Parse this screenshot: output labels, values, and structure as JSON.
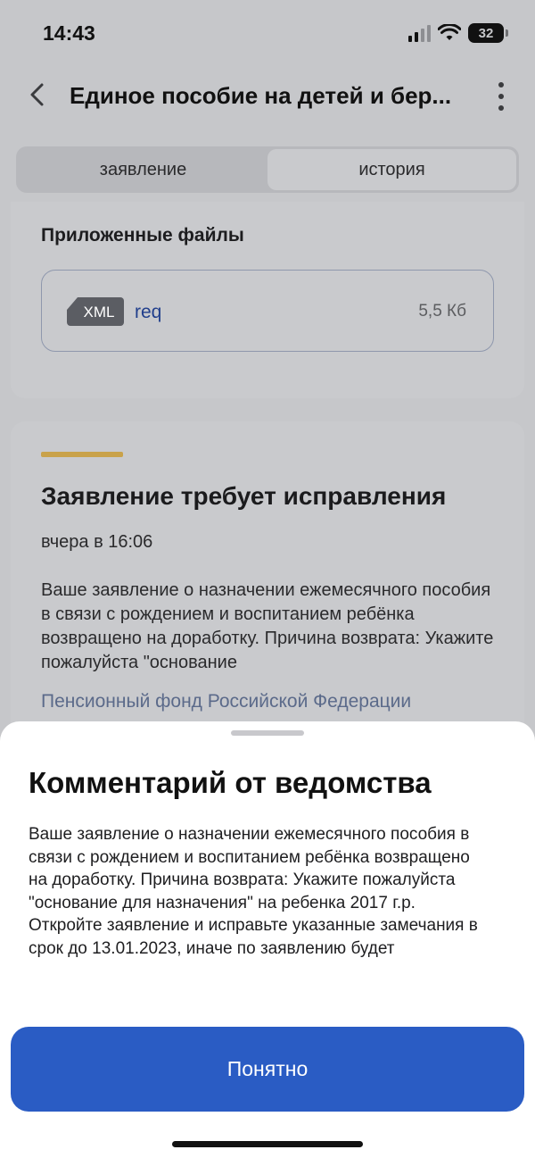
{
  "status_bar": {
    "time": "14:43",
    "battery": "32"
  },
  "header": {
    "title": "Единое пособие на детей и бер..."
  },
  "tabs": [
    {
      "label": "заявление",
      "active": false
    },
    {
      "label": "история",
      "active": true
    }
  ],
  "attachments": {
    "title": "Приложенные файлы",
    "file": {
      "type": "XML",
      "name": "req",
      "size": "5,5 Кб"
    }
  },
  "status_card": {
    "title": "Заявление требует исправления",
    "date": "вчера в 16:06",
    "text": "Ваше заявление о назначении ежемесячного пособия в связи с рождением и воспитанием ребёнка возвращено на доработку. Причина возврата: Укажите пожалуйста \"основание",
    "organization": "Пенсионный фонд Российской Федерации",
    "accent_color": "#c9a24a"
  },
  "sheet": {
    "title": "Комментарий от ведомства",
    "text": "Ваше заявление о назначении ежемесячного пособия в связи с рождением и воспитанием ребёнка возвращено на доработку. Причина возврата: Укажите пожалуйста \"основание для назначения\" на ребенка 2017 г.р. Откройте заявление и исправьте указанные замечания в срок до 13.01.2023, иначе по заявлению будет",
    "button_label": "Понятно",
    "button_color": "#2a5cc4"
  }
}
